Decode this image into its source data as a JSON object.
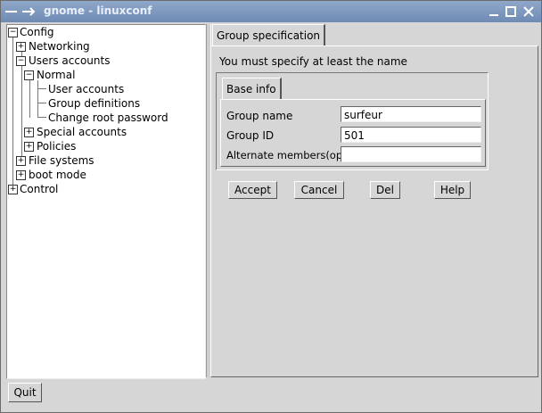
{
  "window": {
    "title": "gnome - linuxconf"
  },
  "tree": {
    "items": [
      {
        "label": "Config"
      },
      {
        "label": "Networking"
      },
      {
        "label": "Users accounts"
      },
      {
        "label": "Normal"
      },
      {
        "label": "User accounts"
      },
      {
        "label": "Group definitions"
      },
      {
        "label": "Change root password"
      },
      {
        "label": "Special accounts"
      },
      {
        "label": "Policies"
      },
      {
        "label": "File systems"
      },
      {
        "label": "boot mode"
      },
      {
        "label": "Control"
      }
    ]
  },
  "main": {
    "tab_label": "Group specification",
    "message": "You must specify at least the name",
    "subtab_label": "Base info",
    "fields": [
      {
        "label": "Group name",
        "value": "surfeur"
      },
      {
        "label": "Group ID",
        "value": "501"
      },
      {
        "label": "Alternate members(opt)",
        "value": ""
      }
    ],
    "buttons": {
      "accept": "Accept",
      "cancel": "Cancel",
      "del": "Del",
      "help": "Help"
    }
  },
  "footer": {
    "quit": "Quit"
  }
}
